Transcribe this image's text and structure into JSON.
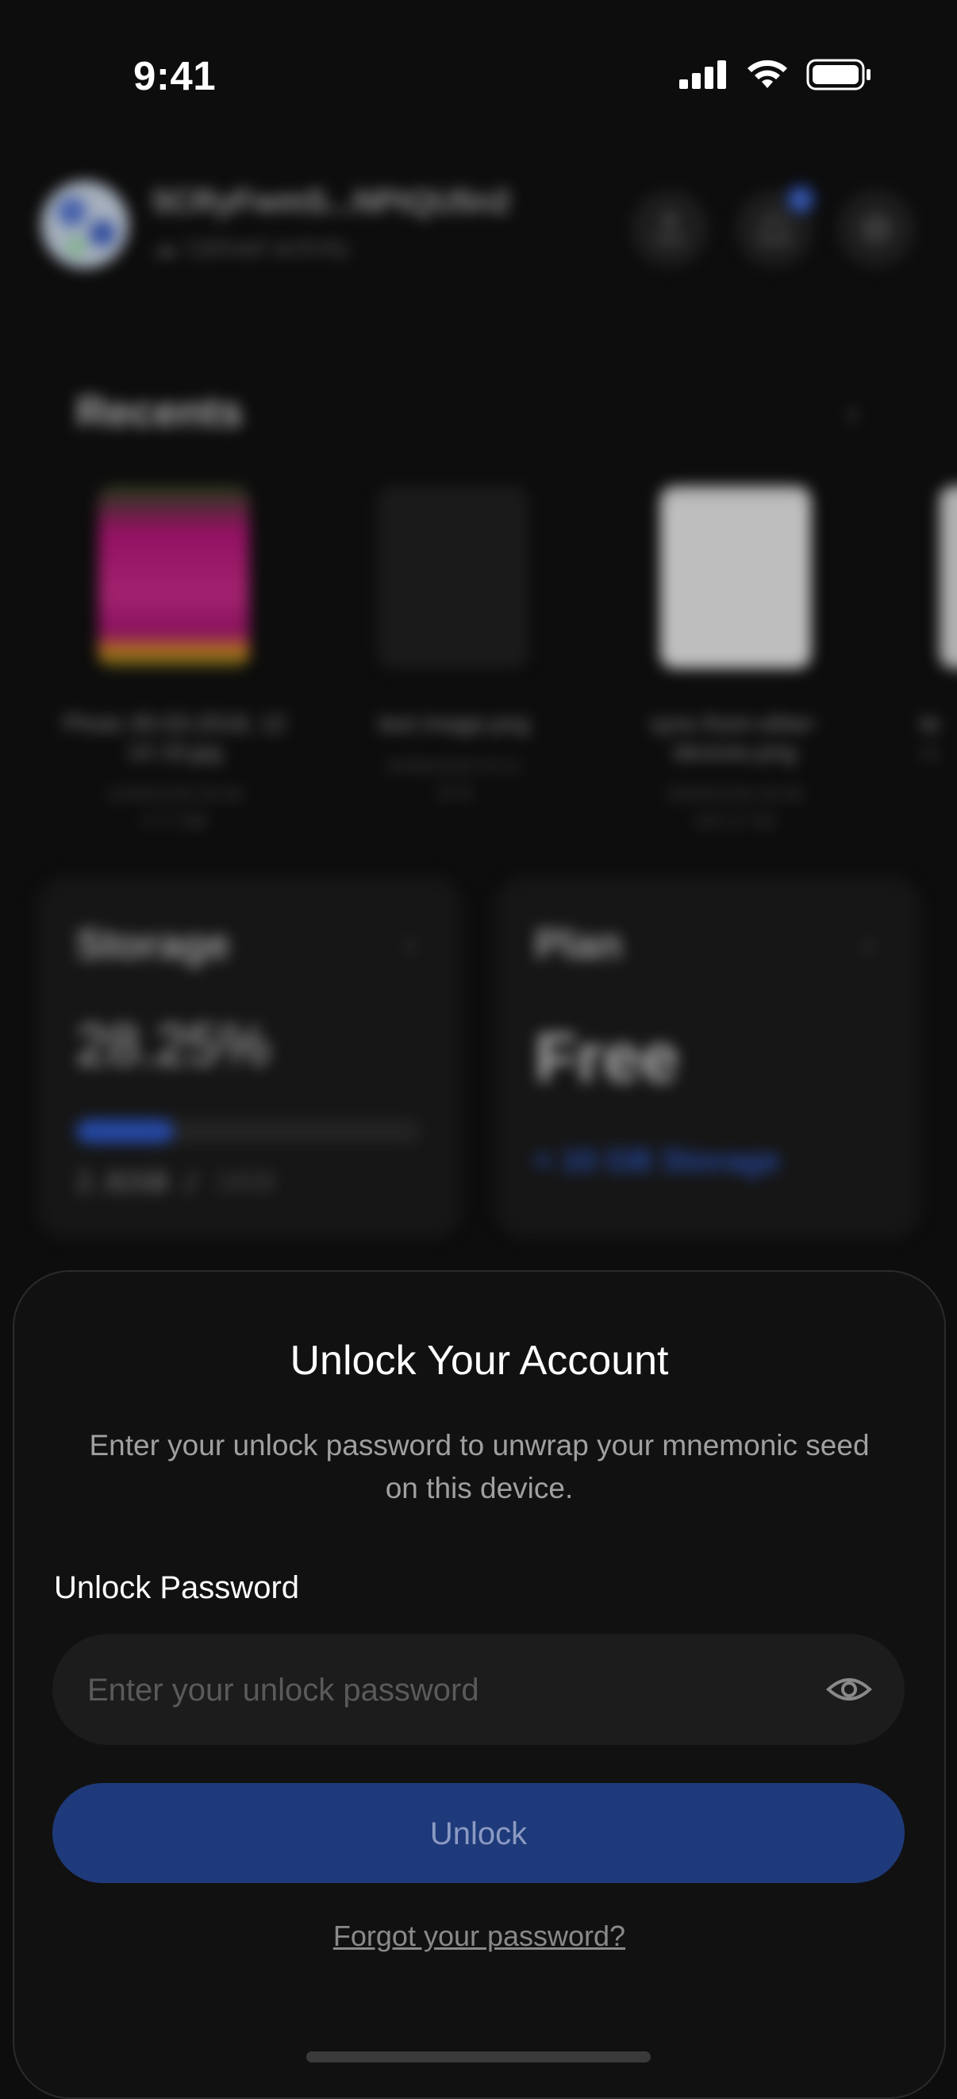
{
  "status_bar": {
    "time": "9:41"
  },
  "header": {
    "account_address": "5CRyFwmS...NPtQU5n2",
    "upload_activity_label": "Upload activity",
    "notification_count": "1",
    "icons": [
      "upload-icon",
      "bell-icon",
      "gear-icon"
    ]
  },
  "recents": {
    "title": "Recents",
    "items": [
      {
        "name_line1": "Photo 30-03-2018, 12",
        "name_line2": "14 19.jpg",
        "meta_line1": "16/06/2026 05:58",
        "meta_line2": "4.77 MB"
      },
      {
        "name_line1": "test image.png",
        "name_line2": "",
        "meta_line1": "04/06/2026 04:11",
        "meta_line2": "20 B"
      },
      {
        "name_line1": "sync-from-other-",
        "name_line2": "devices.png",
        "meta_line1": "06/06/2026 05:58",
        "meta_line2": "425.17 KB"
      },
      {
        "name_line1": "te",
        "name_line2": "",
        "meta_line1": "05",
        "meta_line2": ""
      }
    ]
  },
  "storage": {
    "title": "Storage",
    "percent_text": "28.25%",
    "percent_value": 28.25,
    "used": "2.82GB",
    "separator": " / ",
    "total": "10GB"
  },
  "plan": {
    "title": "Plan",
    "name": "Free",
    "description": "≈ 10 GB Storage"
  },
  "unlock_sheet": {
    "title": "Unlock Your Account",
    "subtitle": "Enter your unlock password to unwrap your mnemonic seed on this device.",
    "password_label": "Unlock Password",
    "password_placeholder": "Enter your unlock password",
    "unlock_button": "Unlock",
    "forgot_link": "Forgot your password?"
  },
  "colors": {
    "accent": "#2d5cd6",
    "button_bg": "#1f3a7a",
    "background": "#0d0d0d",
    "sheet_bg": "#111111"
  }
}
